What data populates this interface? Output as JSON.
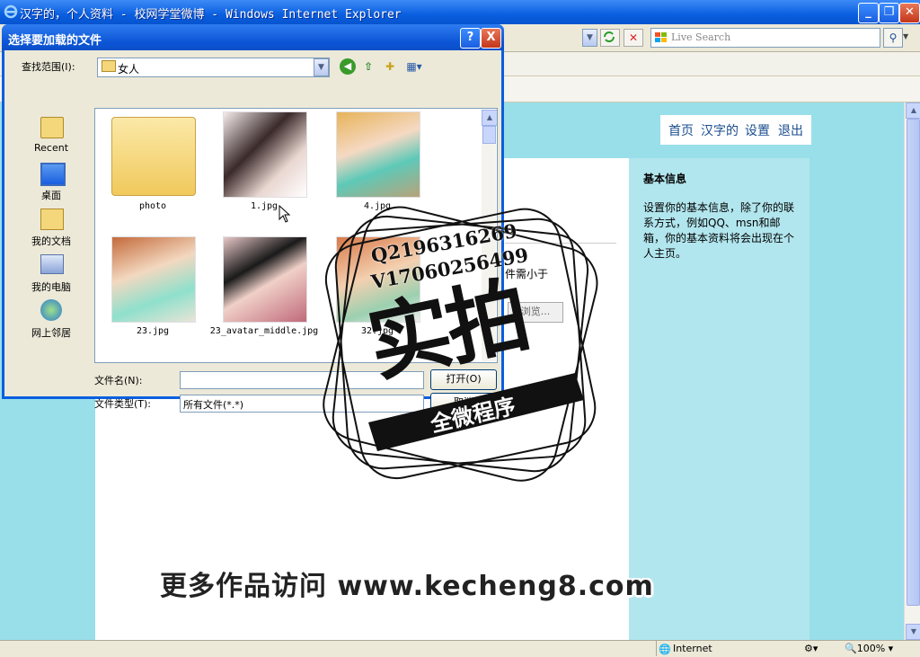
{
  "browser": {
    "title": "汉字的，个人资料 - 校网学堂微博 - Windows Internet Explorer",
    "search_placeholder": "Live Search",
    "status_zone": "Internet",
    "zoom": "100%"
  },
  "page": {
    "nav": [
      "首页",
      "汉字的",
      "设置",
      "退出"
    ],
    "side_heading": "基本信息",
    "side_text": "设置你的基本信息，除了你的联系方式，例如QQ、msn和邮箱，你的基本资料将会出现在个人主页。",
    "partial_note": "件需小于",
    "browse_label": "浏览..."
  },
  "dialog": {
    "title": "选择要加载的文件",
    "look_in_label": "查找范围(I):",
    "look_in_value": "女人",
    "places": [
      "Recent",
      "桌面",
      "我的文档",
      "我的电脑",
      "网上邻居"
    ],
    "files": [
      "photo",
      "1.jpg",
      "4.jpg",
      "23.jpg",
      "23_avatar_middle.jpg",
      "32.jpg"
    ],
    "filename_label": "文件名(N):",
    "filename_value": "",
    "filetype_label": "文件类型(T):",
    "filetype_value": "所有文件(*.*)",
    "open_label": "打开(O)",
    "cancel_label": "取消",
    "help_label": "?",
    "close_label": "X"
  },
  "overlay": {
    "stamp_line1": "Q2196316269",
    "stamp_line2": "V17060256499",
    "stamp_main": "实拍",
    "stamp_banner": "全微程序",
    "watermark": "更多作品访问 www.kecheng8.com"
  },
  "colors": {
    "xp_blue": "#0a5fe0",
    "page_bg": "#99dfe9",
    "nav_link": "#1a4d8f"
  }
}
